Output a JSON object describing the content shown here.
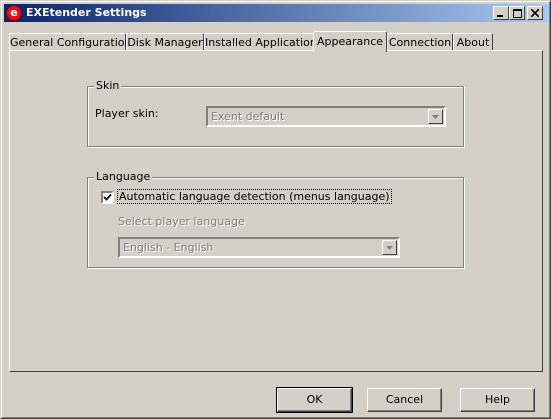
{
  "window": {
    "title": "EXEtender Settings",
    "icon_letter": "e"
  },
  "title_buttons": {
    "minimize": "minimize-icon",
    "maximize": "maximize-icon",
    "close": "close-icon"
  },
  "tabs": [
    {
      "label": "General Configuration"
    },
    {
      "label": "Disk Manager"
    },
    {
      "label": "Installed Applications"
    },
    {
      "label": "Appearance",
      "active": true
    },
    {
      "label": "Connection"
    },
    {
      "label": "About"
    }
  ],
  "skin": {
    "group_title": "Skin",
    "player_skin_label": "Player skin:",
    "player_skin_value": "Exent default"
  },
  "language": {
    "group_title": "Language",
    "auto_detect_label": "Automatic language detection (menus language)",
    "auto_detect_checked": true,
    "select_label": "Select player language",
    "select_value": "English - English"
  },
  "buttons": {
    "ok": "OK",
    "cancel": "Cancel",
    "help": "Help"
  }
}
